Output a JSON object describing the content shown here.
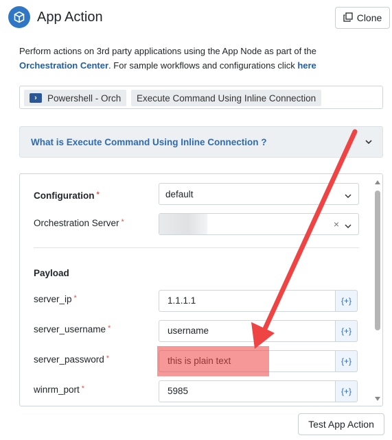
{
  "header": {
    "title": "App Action",
    "clone_label": "Clone"
  },
  "description": {
    "text_part1": "Perform actions on 3rd party applications using the App Node as part of the",
    "link_orchestration": "Orchestration Center",
    "text_part2": ". For sample workflows and configurations click ",
    "link_here": "here"
  },
  "connector": {
    "app_name": "Powershell - Orch",
    "action_name": "Execute Command Using Inline Connection"
  },
  "accordion": {
    "title": "What is Execute Command Using Inline Connection ?"
  },
  "form": {
    "configuration": {
      "label": "Configuration",
      "value": "default"
    },
    "orchestration_server": {
      "label": "Orchestration Server",
      "value": ""
    },
    "payload_label": "Payload",
    "fields": [
      {
        "label": "server_ip",
        "value": "1.1.1.1",
        "var_label": "{+}"
      },
      {
        "label": "server_username",
        "value": "username",
        "var_label": "{+}"
      },
      {
        "label": "server_password",
        "value": "this is plain text",
        "var_label": "{+}"
      },
      {
        "label": "winrm_port",
        "value": "5985",
        "var_label": "{+}"
      }
    ],
    "required_marker": "*",
    "clear_symbol": "×"
  },
  "footer": {
    "test_label": "Test App Action"
  },
  "colors": {
    "accent_blue": "#2f76c4",
    "link_blue": "#1f5ea8",
    "required_red": "#d9534f",
    "annotation_red": "#ef4444"
  }
}
